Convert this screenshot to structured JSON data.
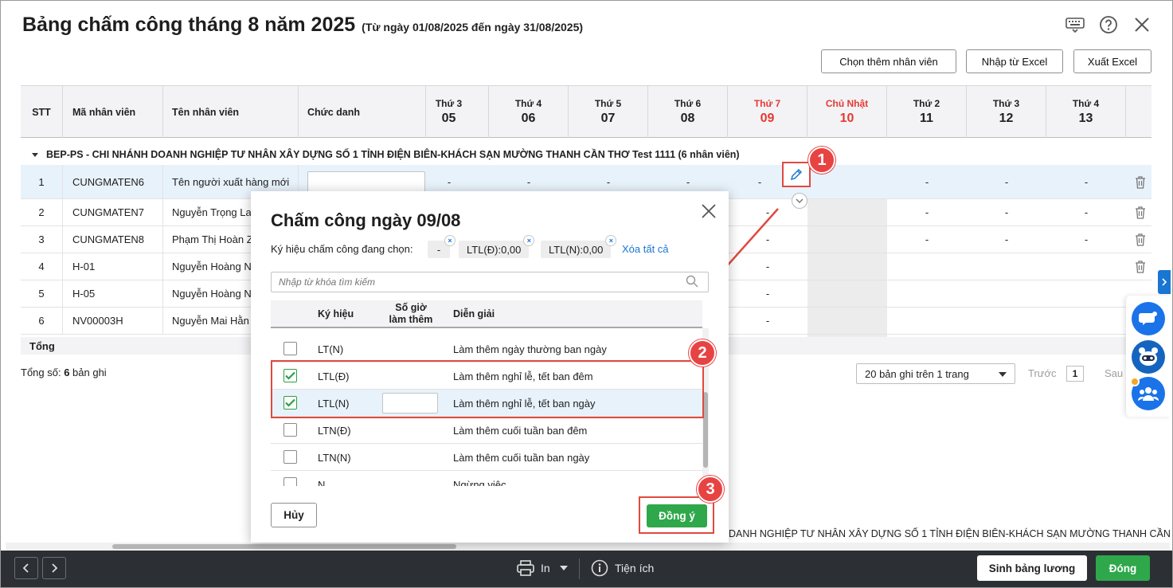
{
  "title": "Bảng chấm công tháng 8 năm 2025",
  "subtitle": "(Từ ngày 01/08/2025 đến ngày 31/08/2025)",
  "toolbar": {
    "add_employee": "Chọn thêm nhân viên",
    "import_excel": "Nhập từ Excel",
    "export_excel": "Xuất Excel"
  },
  "grid": {
    "headers": {
      "stt": "STT",
      "ma": "Mã nhân viên",
      "ten": "Tên nhân viên",
      "chuc": "Chức danh"
    },
    "days": [
      {
        "dow": "Thứ 3",
        "num": "05"
      },
      {
        "dow": "Thứ 4",
        "num": "06"
      },
      {
        "dow": "Thứ 5",
        "num": "07"
      },
      {
        "dow": "Thứ 6",
        "num": "08"
      },
      {
        "dow": "Thứ 7",
        "num": "09"
      },
      {
        "dow": "Chủ Nhật",
        "num": "10"
      },
      {
        "dow": "Thứ 2",
        "num": "11"
      },
      {
        "dow": "Thứ 3",
        "num": "12"
      },
      {
        "dow": "Thứ 4",
        "num": "13"
      }
    ],
    "group": "BEP-PS - CHI NHÁNH DOANH NGHIỆP TƯ NHÂN XÂY DỰNG SỐ 1 TỈNH ĐIỆN BIÊN-KHÁCH SẠN MƯỜNG THANH CẦN THƠ Test 1111 (6 nhân viên)",
    "rows": [
      {
        "stt": "1",
        "ma": "CUNGMATEN6",
        "ten": "Tên người xuất hàng mới"
      },
      {
        "stt": "2",
        "ma": "CUNGMATEN7",
        "ten": "Nguyễn Trọng La"
      },
      {
        "stt": "3",
        "ma": "CUNGMATEN8",
        "ten": "Phạm Thị Hoàn Z"
      },
      {
        "stt": "4",
        "ma": "H-01",
        "ten": "Nguyễn Hoàng N"
      },
      {
        "stt": "5",
        "ma": "H-05",
        "ten": "Nguyễn Hoàng N"
      },
      {
        "stt": "6",
        "ma": "NV00003H",
        "ten": "Nguyễn Mai Hằn"
      }
    ],
    "dash": "-",
    "total_label": "Tổng"
  },
  "footer": {
    "count_prefix": "Tổng số: ",
    "count_value": "6",
    "count_suffix": " bản ghi",
    "page_size": "20 bản ghi trên 1 trang",
    "prev": "Trước",
    "page": "1",
    "next": "Sau",
    "marquee": "DANH NGHIỆP TƯ NHÂN XÂY DỰNG SỐ 1 TỈNH ĐIỆN BIÊN-KHÁCH SẠN MƯỜNG THANH CẦN THƠ"
  },
  "bottombar": {
    "print": "In",
    "utilities": "Tiện ích",
    "salary": "Sinh bảng lương",
    "close": "Đóng"
  },
  "dialog": {
    "title": "Chấm công ngày 09/08",
    "chips_label": "Ký hiệu chấm công đang chọn:",
    "chips": [
      "-",
      "LTL(Đ):0,00",
      "LTL(N):0,00"
    ],
    "clear_all": "Xóa tất cả",
    "search_placeholder": "Nhập từ khóa tìm kiếm",
    "headers": {
      "symbol": "Ký hiệu",
      "overtime_1": "Số giờ",
      "overtime_2": "làm thêm",
      "desc": "Diễn giải"
    },
    "rows": [
      {
        "symbol": "LT(N)",
        "desc": "Làm thêm ngày thường ban ngày",
        "checked": false
      },
      {
        "symbol": "LTL(Đ)",
        "desc": "Làm thêm nghỉ lễ, tết ban đêm",
        "checked": true
      },
      {
        "symbol": "LTL(N)",
        "desc": "Làm thêm nghỉ lễ, tết ban ngày",
        "checked": true
      },
      {
        "symbol": "LTN(Đ)",
        "desc": "Làm thêm cuối tuần ban đêm",
        "checked": false
      },
      {
        "symbol": "LTN(N)",
        "desc": "Làm thêm cuối tuần ban ngày",
        "checked": false
      },
      {
        "symbol": "N",
        "desc": "Ngừng việc",
        "checked": false
      }
    ],
    "cancel": "Hủy",
    "agree": "Đồng ý"
  },
  "steps": [
    "1",
    "2",
    "3"
  ],
  "colors": {
    "accent_green": "#2ea84a",
    "weekend_red": "#e53935",
    "link_blue": "#1976d2",
    "callout_red": "#e04a3f"
  }
}
